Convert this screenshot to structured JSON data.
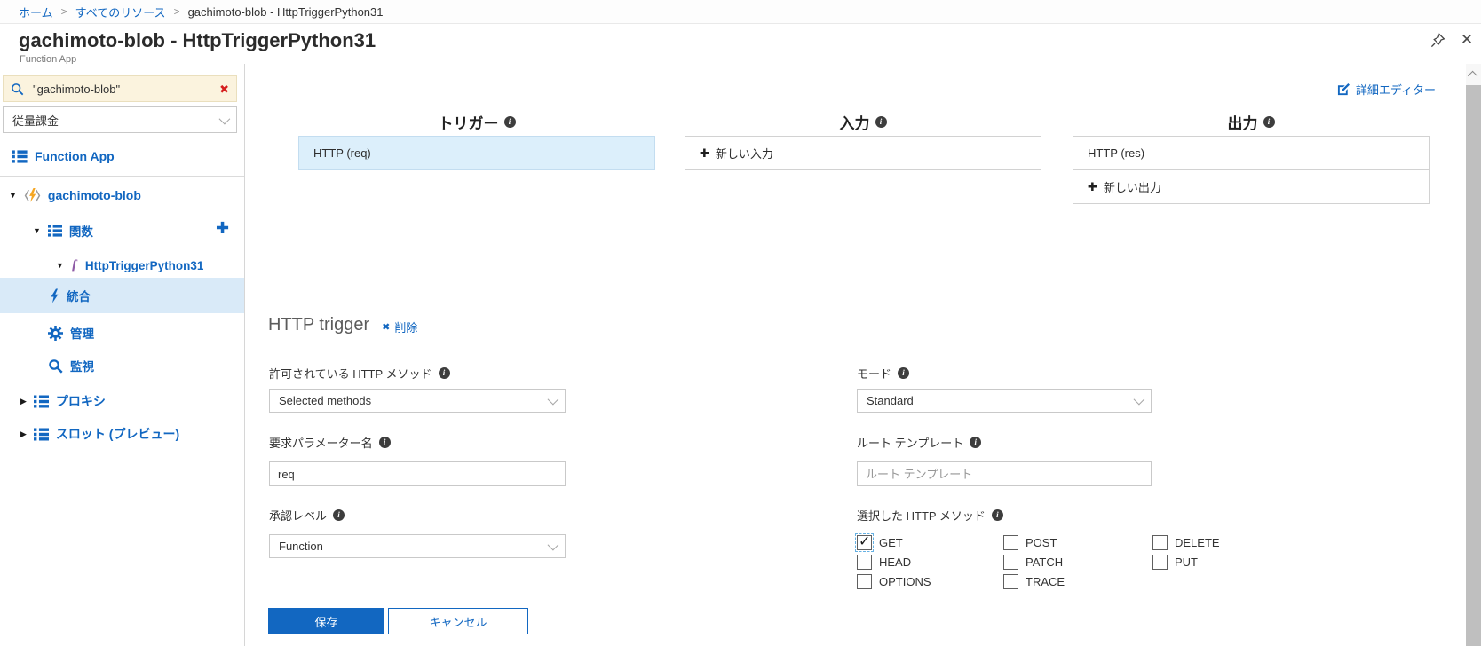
{
  "breadcrumb": {
    "separator": ">",
    "items": [
      "ホーム",
      "すべてのリソース",
      "gachimoto-blob - HttpTriggerPython31"
    ]
  },
  "header": {
    "title": "gachimoto-blob - HttpTriggerPython31",
    "subtitle": "Function App"
  },
  "sidebar": {
    "search_value": "\"gachimoto-blob\"",
    "plan_value": "従量課金",
    "function_app_label": "Function App",
    "app_name": "gachimoto-blob",
    "functions_label": "関数",
    "function_name": "HttpTriggerPython31",
    "items": {
      "integrate": "統合",
      "manage": "管理",
      "monitor": "監視",
      "proxies": "プロキシ",
      "slots": "スロット (プレビュー)"
    }
  },
  "main": {
    "advanced_editor_label": "詳細エディター",
    "columns": {
      "trigger_title": "トリガー",
      "input_title": "入力",
      "output_title": "出力",
      "trigger_item": "HTTP (req)",
      "new_input_label": "新しい入力",
      "output_item": "HTTP (res)",
      "new_output_label": "新しい出力",
      "plus_glyph": "✚"
    },
    "section_title": "HTTP trigger",
    "delete_label": "削除",
    "delete_x": "✖",
    "form": {
      "allowed_methods_label": "許可されている HTTP メソッド",
      "allowed_methods_value": "Selected methods",
      "mode_label": "モード",
      "mode_value": "Standard",
      "request_param_label": "要求パラメーター名",
      "request_param_value": "req",
      "route_template_label": "ルート テンプレート",
      "route_template_placeholder": "ルート テンプレート",
      "auth_level_label": "承認レベル",
      "auth_level_value": "Function",
      "selected_methods_label": "選択した HTTP メソッド",
      "methods": [
        {
          "label": "GET",
          "checked": true
        },
        {
          "label": "HEAD",
          "checked": false
        },
        {
          "label": "OPTIONS",
          "checked": false
        },
        {
          "label": "POST",
          "checked": false
        },
        {
          "label": "PATCH",
          "checked": false
        },
        {
          "label": "TRACE",
          "checked": false
        },
        {
          "label": "DELETE",
          "checked": false
        },
        {
          "label": "PUT",
          "checked": false
        }
      ]
    },
    "save_label": "保存",
    "cancel_label": "キャンセル"
  },
  "misc": {
    "info_glyph": "i",
    "clear_glyph": "✖",
    "close_glyph": "✕",
    "plus_sidebar": "✚"
  },
  "colors": {
    "accent": "#1267C1",
    "selected_bg": "#D9EAF8",
    "trigger_bg": "#DCEFFB",
    "search_bg": "#FBF3DE",
    "clear_red": "#D61F1F",
    "lightning": "#F5A623",
    "function_f": "#8E5BA6"
  }
}
